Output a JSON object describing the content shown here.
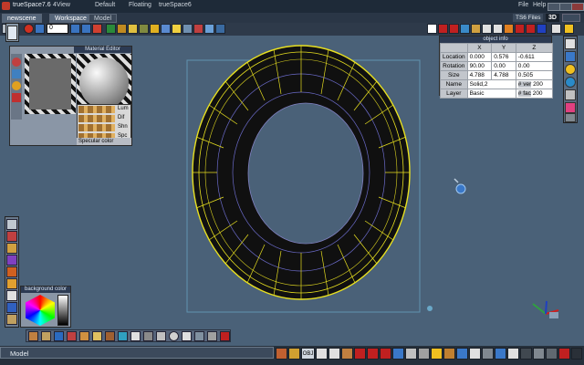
{
  "app": {
    "title": "trueSpace7.6",
    "menu": [
      "4View",
      "Default",
      "Floating",
      "trueSpace6"
    ],
    "topright": [
      "File",
      "Help"
    ],
    "window_tag": "TS6 Files",
    "view_mode": "3D"
  },
  "tabs": [
    "newscene",
    "Workspace",
    "Model"
  ],
  "toolbar": {
    "frame_value": "0"
  },
  "material_editor": {
    "title": "Material Editor",
    "channels": [
      "Lum",
      "Dif",
      "Shn",
      "Spc"
    ],
    "specular_label": "Specular color"
  },
  "object_info": {
    "title": "object info",
    "columns": [
      "X",
      "Y",
      "Z"
    ],
    "rows": [
      {
        "label": "Location",
        "x": "0.000",
        "y": "0.576",
        "z": "-0.611"
      },
      {
        "label": "Rotation",
        "x": "90.00",
        "y": "0.00",
        "z": "0.00"
      },
      {
        "label": "Size",
        "x": "4.788",
        "y": "4.788",
        "z": "0.505"
      }
    ],
    "name_label": "Name",
    "name_value": "Solid,2",
    "layer_label": "Layer",
    "layer_value": "Basic",
    "ver_label": "# ver",
    "ver_value": "200",
    "fac_label": "# fac",
    "fac_value": "200"
  },
  "background_panel": {
    "title": "background color"
  },
  "status": {
    "mode": "Model",
    "obj_label": "OBJ"
  },
  "colors": {
    "viewport_bg": "#4a6178",
    "wire_selected": "#e8e020",
    "wire_inner": "#7070d0",
    "bbox": "#6aa8c8"
  }
}
